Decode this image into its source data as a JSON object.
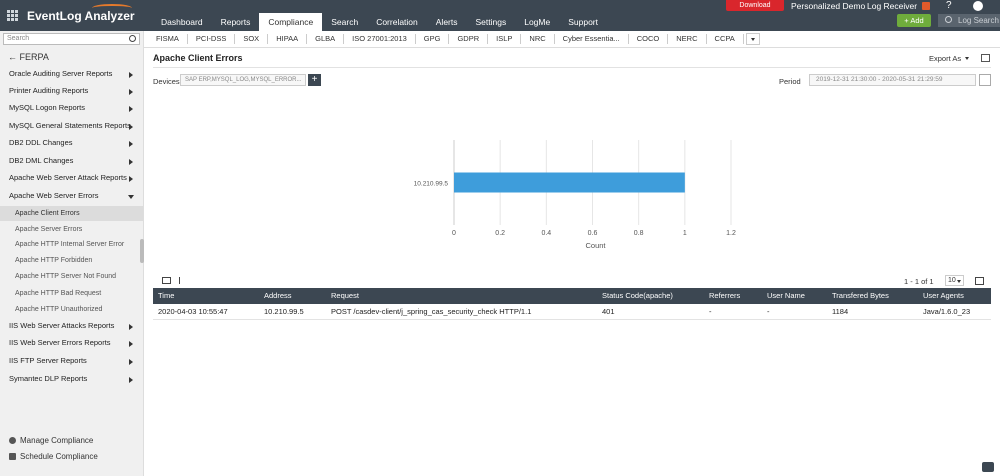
{
  "app": {
    "brand": "EventLog Analyzer",
    "nav": [
      "Dashboard",
      "Reports",
      "Compliance",
      "Search",
      "Correlation",
      "Alerts",
      "Settings",
      "LogMe",
      "Support"
    ],
    "active_nav": "Compliance",
    "download_label": "Download",
    "personalized_demo": "Personalized Demo",
    "log_receiver": "Log Receiver",
    "help_label": "?",
    "add_label": "+ Add",
    "log_search_placeholder": "Log Search"
  },
  "sidebar": {
    "search_placeholder": "Search",
    "back_label": "FERPA",
    "items_top": [
      "Oracle Auditing Server Reports",
      "Printer Auditing Reports",
      "MySQL Logon Reports",
      "MySQL General Statements Reports",
      "DB2 DDL Changes",
      "DB2 DML Changes",
      "Apache Web Server Attack Reports",
      "Apache Web Server Errors"
    ],
    "sub_items": [
      "Apache Client Errors",
      "Apache Server Errors",
      "Apache HTTP Internal Server Error",
      "Apache HTTP Forbidden",
      "Apache HTTP Server Not Found",
      "Apache HTTP Bad Request",
      "Apache HTTP Unauthorized"
    ],
    "active_sub": "Apache Client Errors",
    "items_bottom": [
      "IIS Web Server Attacks Reports",
      "IIS Web Server Errors Reports",
      "IIS FTP Server Reports",
      "Symantec DLP Reports"
    ],
    "footer": [
      "Manage Compliance",
      "Schedule Compliance"
    ]
  },
  "compliance_tabs": [
    "FISMA",
    "PCI-DSS",
    "SOX",
    "HIPAA",
    "GLBA",
    "ISO 27001:2013",
    "GPG",
    "GDPR",
    "ISLP",
    "NRC",
    "Cyber Essentia...",
    "COCO",
    "NERC",
    "CCPA"
  ],
  "report": {
    "title": "Apache Client Errors",
    "export_label": "Export As",
    "devices_label": "Devices",
    "devices_value": "SAP ERP,MYSQL_LOG,MYSQL_ERROR...",
    "period_label": "Period",
    "period_value": "2019-12-31 21:30:00 - 2020-05-31 21:29:59"
  },
  "chart_data": {
    "type": "bar",
    "orientation": "horizontal",
    "categories": [
      "10.210.99.5"
    ],
    "values": [
      1
    ],
    "xlabel": "Count",
    "ylabel": "",
    "xlim": [
      0,
      1.2
    ],
    "ticks": [
      "0",
      "0.2",
      "0.4",
      "0.6",
      "0.8",
      "1",
      "1.2"
    ],
    "bar_color": "#3e9ddb",
    "grid": true
  },
  "table": {
    "pager": "1 - 1 of 1",
    "per_page": "10",
    "columns": [
      "Time",
      "Address",
      "Request",
      "Status Code(apache)",
      "Referrers",
      "User Name",
      "Transfered Bytes",
      "User Agents"
    ],
    "rows": [
      [
        "2020-04-03 10:55:47",
        "10.210.99.5",
        "POST /casdev-client/j_spring_cas_security_check HTTP/1.1",
        "401",
        "-",
        "-",
        "1184",
        "Java/1.6.0_23"
      ]
    ]
  },
  "colors": {
    "topbar": "#3c4752",
    "download": "#d9262c",
    "add": "#6fac3c",
    "bar": "#3e9ddb"
  }
}
